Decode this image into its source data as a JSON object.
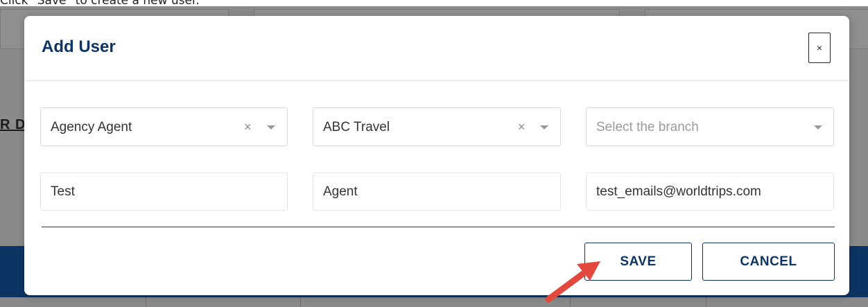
{
  "instruction": "Click \"Save\" to create a new user.",
  "background": {
    "peek_text": "R D"
  },
  "modal": {
    "title": "Add User",
    "close_label": "×",
    "selects": [
      {
        "value": "Agency Agent",
        "placeholder": "",
        "clearable": true
      },
      {
        "value": "ABC Travel",
        "placeholder": "",
        "clearable": true
      },
      {
        "value": "",
        "placeholder": "Select the branch",
        "clearable": false
      }
    ],
    "clear_glyph": "×",
    "inputs": [
      {
        "value": "Test"
      },
      {
        "value": "Agent"
      },
      {
        "value": "test_emails@worldtrips.com"
      }
    ],
    "buttons": {
      "save": "SAVE",
      "cancel": "CANCEL"
    }
  },
  "colors": {
    "brand": "#0d3462",
    "annotation_arrow": "#e2483c",
    "overlay": "#8a8a8a"
  },
  "annotation": {
    "type": "arrow",
    "points_to": "save-button"
  }
}
